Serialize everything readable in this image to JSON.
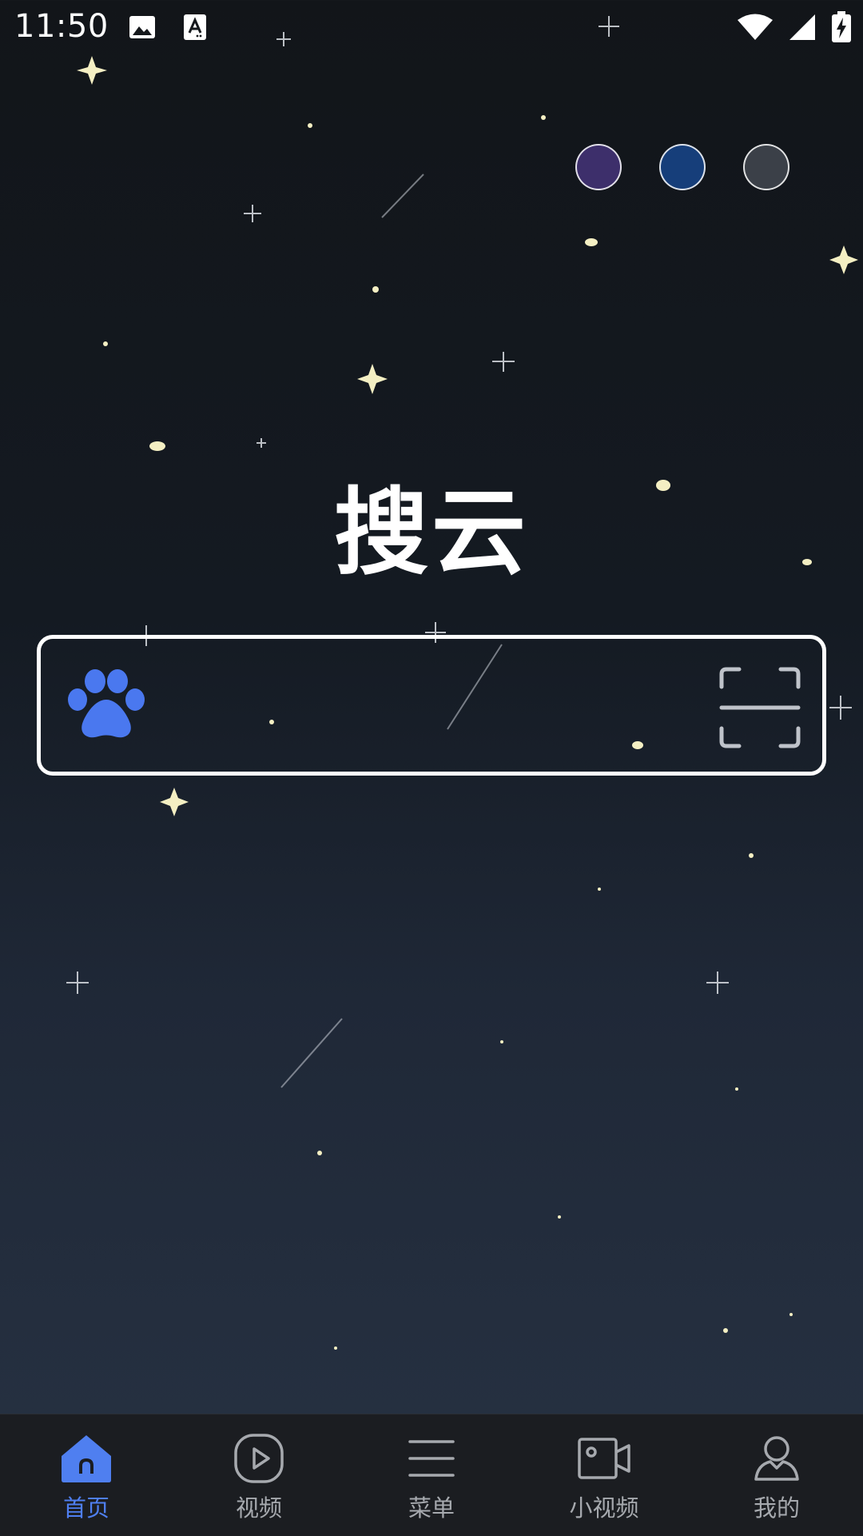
{
  "status_bar": {
    "time": "11:50",
    "left_icons": [
      "image-icon",
      "text-a-icon"
    ],
    "right_icons": [
      "wifi-icon",
      "cell-signal-icon",
      "battery-charging-icon"
    ]
  },
  "theme_dots": [
    {
      "name": "purple",
      "color": "#3d2f6b"
    },
    {
      "name": "blue",
      "color": "#163e7a"
    },
    {
      "name": "gray",
      "color": "#3b4048"
    }
  ],
  "logo": {
    "text": "搜云"
  },
  "search": {
    "value": "",
    "placeholder": "",
    "left_icon": "paw-icon",
    "right_icon": "scan-icon",
    "accent_color": "#4a78ef"
  },
  "bottom_nav": {
    "items": [
      {
        "label": "首页",
        "icon": "home-icon",
        "active": true
      },
      {
        "label": "视频",
        "icon": "play-circle-icon",
        "active": false
      },
      {
        "label": "菜单",
        "icon": "menu-icon",
        "active": false
      },
      {
        "label": "小视频",
        "icon": "video-camera-icon",
        "active": false
      },
      {
        "label": "我的",
        "icon": "user-icon",
        "active": false
      }
    ],
    "active_color": "#4f7ff0",
    "inactive_color": "#a6a9ae"
  }
}
